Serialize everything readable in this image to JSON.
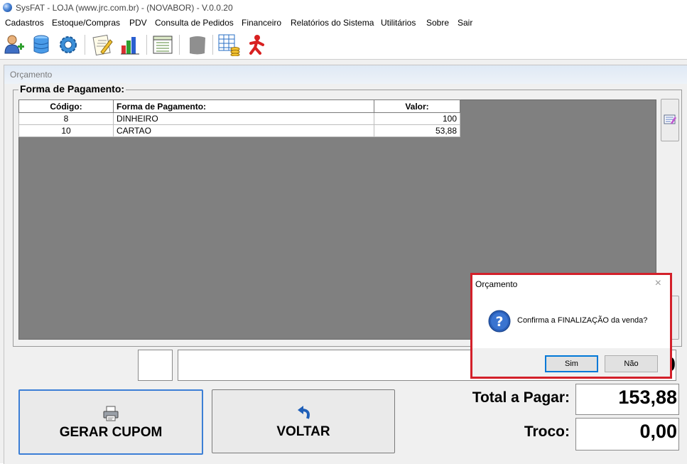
{
  "window": {
    "title": "SysFAT - LOJA (www.jrc.com.br) - (NOVABOR) - V.0.0.20"
  },
  "menu": [
    "Cadastros",
    "Estoque/Compras",
    "PDV",
    "Consulta de Pedidos",
    "Financeiro",
    "Relatórios do Sistema",
    "Utilitários",
    "Sobre",
    "Sair"
  ],
  "toolbar": {
    "icons": [
      "user-add-icon",
      "database-icon",
      "settings-gear-icon",
      "document-edit-icon",
      "bar-chart-icon",
      "report-list-icon",
      "disabled-icon",
      "spreadsheet-coins-icon",
      "exit-figure-icon"
    ]
  },
  "form": {
    "title": "Orçamento",
    "group_title": "Forma de Pagamento:",
    "columns": [
      "Código:",
      "Forma de Pagamento:",
      "Valor:"
    ],
    "rows": [
      {
        "codigo": "8",
        "forma": "DINHEIRO",
        "valor": "100"
      },
      {
        "codigo": "10",
        "forma": "CARTAO",
        "valor": "53,88"
      }
    ],
    "partial_value": "0",
    "gerar_cupom": "GERAR CUPOM",
    "voltar": "VOLTAR",
    "total_label": "Total a Pagar:",
    "total_value": "153,88",
    "troco_label": "Troco:",
    "troco_value": "0,00"
  },
  "dialog": {
    "title": "Orçamento",
    "close": "×",
    "message": "Confirma a FINALIZAÇÃO da venda?",
    "yes": "Sim",
    "no": "Não"
  },
  "colors": {
    "highlight": "#d3202a",
    "grid_bg": "#808080",
    "accent": "#3c7fd6"
  }
}
